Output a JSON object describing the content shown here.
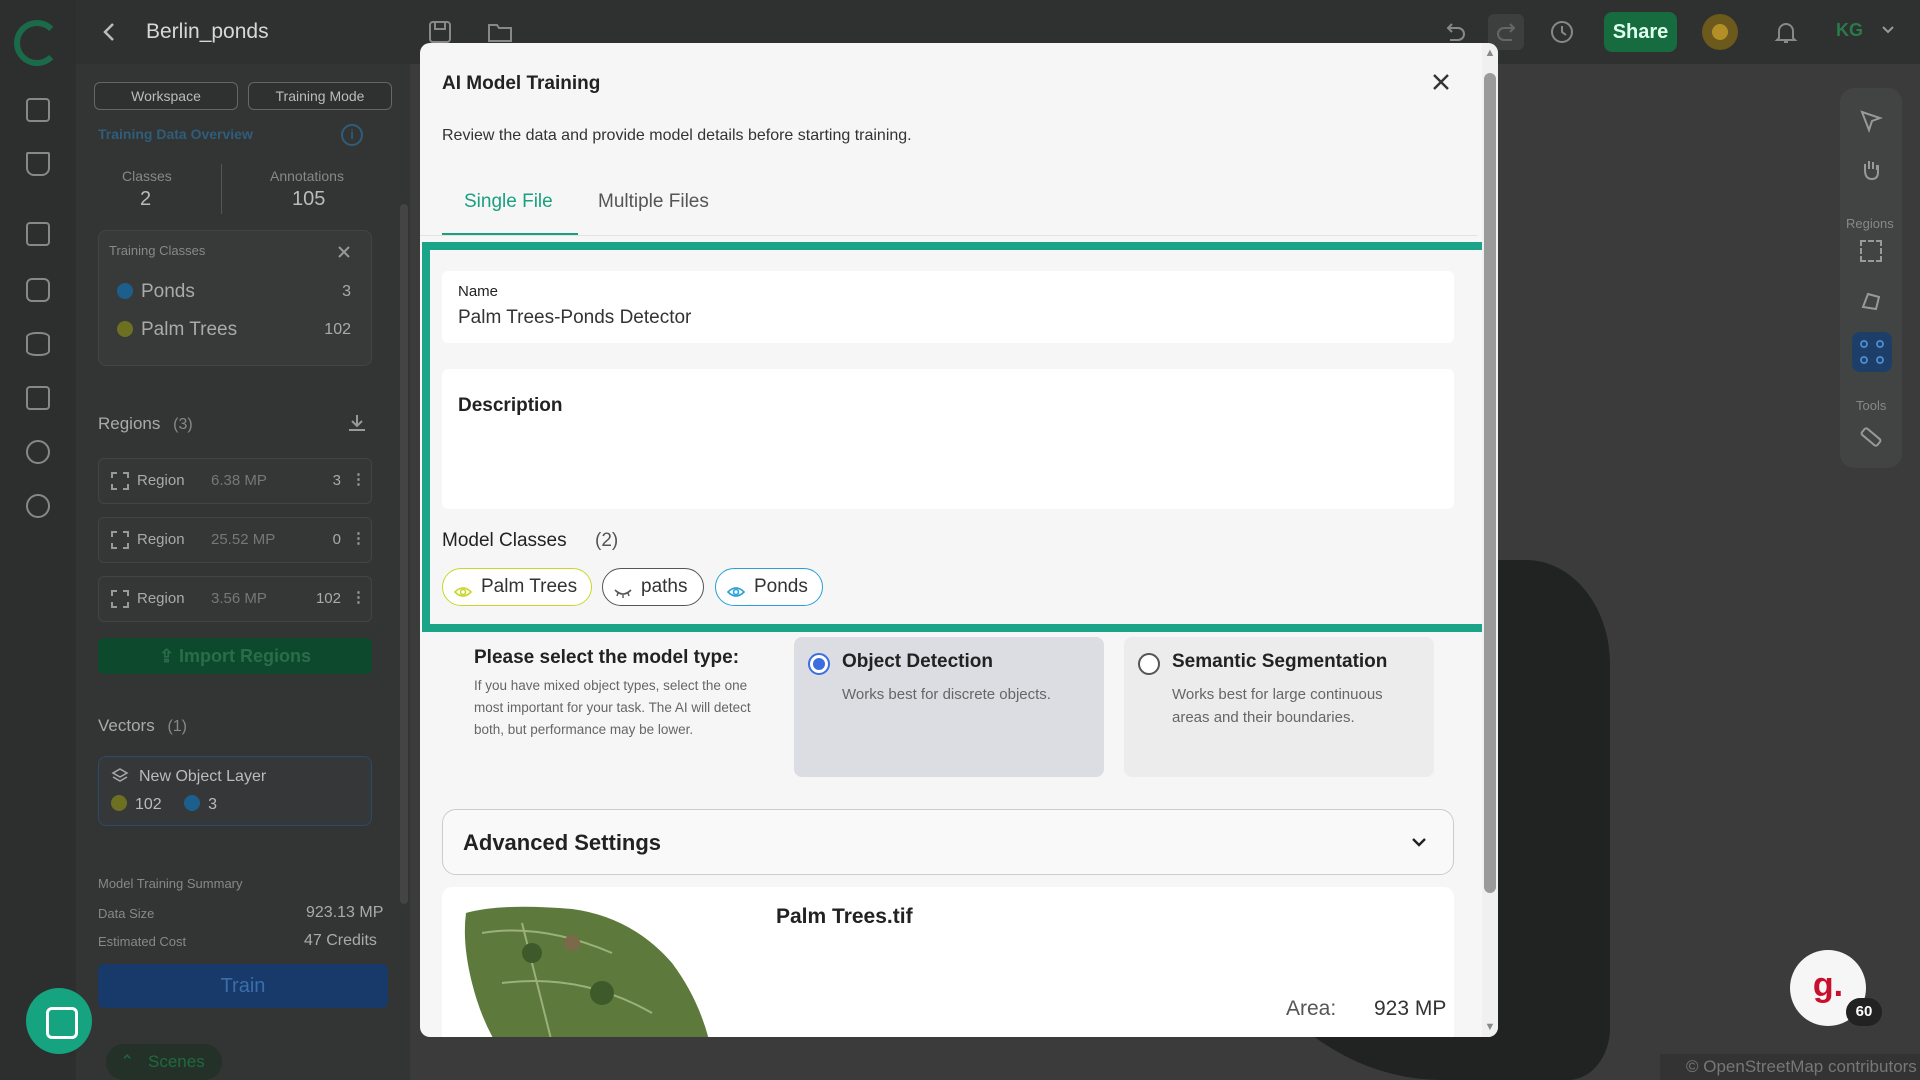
{
  "header": {
    "project_title": "Berlin_ponds",
    "share_label": "Share",
    "user_initials": "KG"
  },
  "panel": {
    "workspace_label": "Workspace",
    "training_mode_label": "Training Mode",
    "overview_title": "Training Data Overview",
    "classes_label": "Classes",
    "classes_value": "2",
    "annotations_label": "Annotations",
    "annotations_value": "105",
    "training_classes_title": "Training Classes",
    "training_classes": [
      {
        "name": "Ponds",
        "count": "3",
        "color": "#1d5f8c"
      },
      {
        "name": "Palm Trees",
        "count": "102",
        "color": "#6d7020"
      }
    ],
    "regions_title": "Regions",
    "regions_count": "(3)",
    "regions": [
      {
        "label": "Region",
        "size": "6.38 MP",
        "count": "3"
      },
      {
        "label": "Region",
        "size": "25.52 MP",
        "count": "0"
      },
      {
        "label": "Region",
        "size": "3.56 MP",
        "count": "102"
      }
    ],
    "import_label": "Import Regions",
    "vectors_title": "Vectors",
    "vectors_count": "(1)",
    "layer_name": "New Object Layer",
    "layer_count_1": "102",
    "layer_count_2": "3",
    "summary_title": "Model Training Summary",
    "data_size_label": "Data Size",
    "data_size_value": "923.13 MP",
    "cost_label": "Estimated Cost",
    "cost_value": "47 Credits",
    "train_label": "Train",
    "scenes_label": "Scenes"
  },
  "map": {
    "tools_regions_label": "Regions",
    "tools_label": "Tools",
    "osm_credit": "© OpenStreetMap contributors",
    "g_badge": "g.",
    "g_count": "60"
  },
  "modal": {
    "title": "AI Model Training",
    "description": "Review the data and provide model details before starting training.",
    "tabs": [
      {
        "label": "Single File"
      },
      {
        "label": "Multiple Files"
      }
    ],
    "name_label": "Name",
    "name_value": "Palm Trees-Ponds Detector",
    "description_label": "Description",
    "model_classes_label": "Model Classes",
    "model_classes_count": "(2)",
    "chips": [
      {
        "label": "Palm Trees",
        "color": "#c8d82a"
      },
      {
        "label": "paths",
        "color": "#555555"
      },
      {
        "label": "Ponds",
        "color": "#2aa0d8"
      }
    ],
    "model_type_title": "Please select the model type:",
    "model_type_note": "If you have mixed object types, select the one most important for your task. The AI will detect both, but performance may be lower.",
    "options": [
      {
        "title": "Object Detection",
        "desc": "Works best for discrete objects.",
        "selected": true
      },
      {
        "title": "Semantic Segmentation",
        "desc": "Works best for large continuous areas and their boundaries.",
        "selected": false
      }
    ],
    "advanced_label": "Advanced Settings",
    "file_name": "Palm Trees.tif",
    "area_label": "Area:",
    "area_value": "923 MP"
  }
}
